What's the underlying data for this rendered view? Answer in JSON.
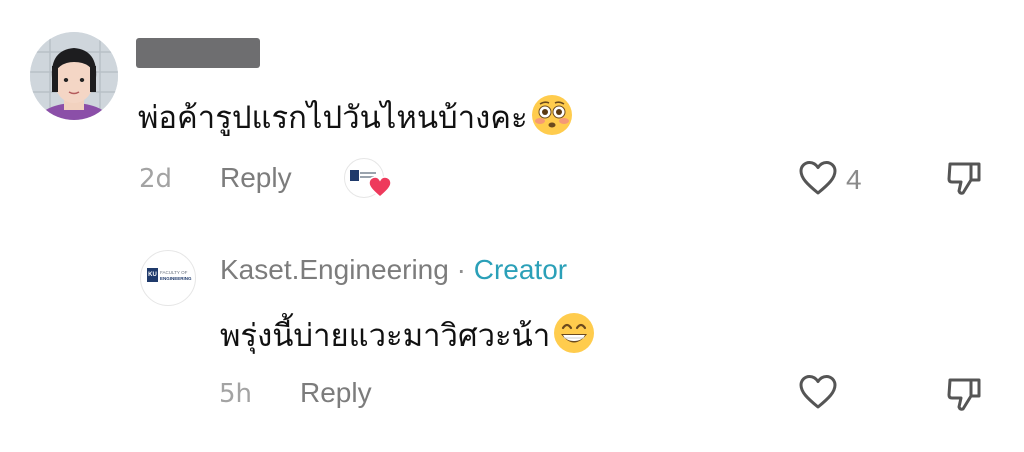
{
  "comments": [
    {
      "text": "พ่อค้ารูปแรกไปวันไหนบ้างคะ",
      "emoji": "flushed-face",
      "time": "2d",
      "reply_label": "Reply",
      "like_count": "4",
      "creator_liked": true
    },
    {
      "username": "Kaset.Engineering",
      "separator": "·",
      "badge": "Creator",
      "avatar_logo_text": "FACULTY OF ENGINEERING",
      "avatar_logo_mark": "KU",
      "text": "พรุ่งนี้บ่ายแวะมาวิศวะน้า",
      "emoji": "grinning-face",
      "time": "5h",
      "reply_label": "Reply"
    }
  ],
  "colors": {
    "creator_badge": "#2ba0b8",
    "like_heart": "#ee3a5c",
    "meta_gray": "#a3a3a3"
  }
}
